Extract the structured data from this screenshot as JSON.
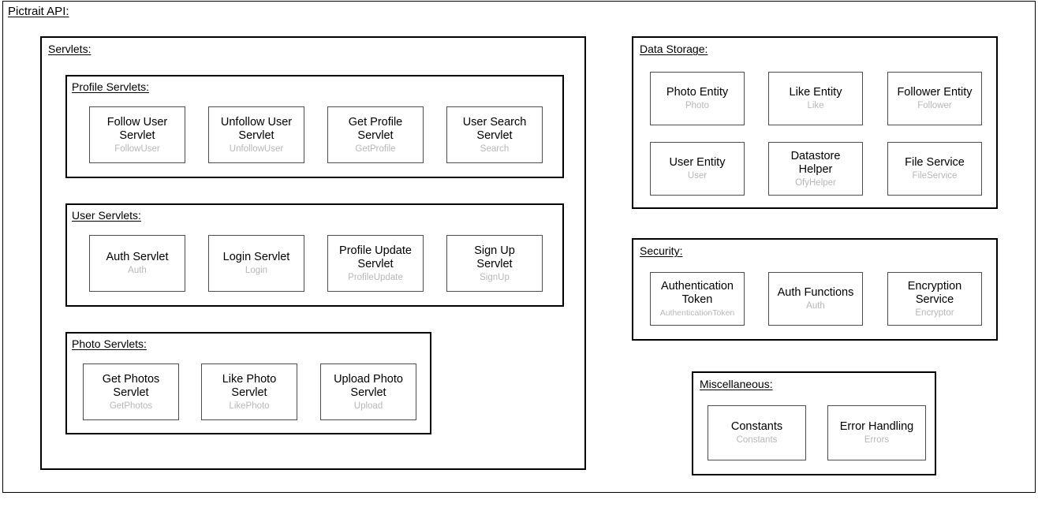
{
  "diagram": {
    "title": "Pictrait API:",
    "type": "architecture-block-diagram"
  },
  "servlets": {
    "title": "Servlets:",
    "profile": {
      "title": "Profile Servlets:",
      "items": [
        {
          "name": "Follow User\nServlet",
          "class": "FollowUser"
        },
        {
          "name": "Unfollow User\nServlet",
          "class": "UnfollowUser"
        },
        {
          "name": "Get Profile\nServlet",
          "class": "GetProfile"
        },
        {
          "name": "User Search\nServlet",
          "class": "Search"
        }
      ]
    },
    "user": {
      "title": "User Servlets:",
      "items": [
        {
          "name": "Auth Servlet",
          "class": "Auth"
        },
        {
          "name": "Login Servlet",
          "class": "Login"
        },
        {
          "name": "Profile Update\nServlet",
          "class": "ProfileUpdate"
        },
        {
          "name": "Sign Up\nServlet",
          "class": "SignUp"
        }
      ]
    },
    "photo": {
      "title": "Photo Servlets:",
      "items": [
        {
          "name": "Get Photos\nServlet",
          "class": "GetPhotos"
        },
        {
          "name": "Like Photo\nServlet",
          "class": "LikePhoto"
        },
        {
          "name": "Upload Photo\nServlet",
          "class": "Upload"
        }
      ]
    }
  },
  "data_storage": {
    "title": "Data Storage:",
    "items": [
      {
        "name": "Photo Entity",
        "class": "Photo"
      },
      {
        "name": "Like Entity",
        "class": "Like"
      },
      {
        "name": "Follower Entity",
        "class": "Follower"
      },
      {
        "name": "User Entity",
        "class": "User"
      },
      {
        "name": "Datastore\nHelper",
        "class": "OfyHelper"
      },
      {
        "name": "File Service",
        "class": "FileService"
      }
    ]
  },
  "security": {
    "title": "Security:",
    "items": [
      {
        "name": "Authentication\nToken",
        "class": "AuthenticationToken"
      },
      {
        "name": "Auth Functions",
        "class": "Auth"
      },
      {
        "name": "Encryption\nService",
        "class": "Encryptor"
      }
    ]
  },
  "miscellaneous": {
    "title": "Miscellaneous:",
    "items": [
      {
        "name": "Constants",
        "class": "Constants"
      },
      {
        "name": "Error Handling",
        "class": "Errors"
      }
    ]
  },
  "colors": {
    "border": "#000000",
    "card_border": "#4d4d4d",
    "text": "#000000",
    "subtext": "#b7b7b7",
    "background": "#ffffff"
  }
}
